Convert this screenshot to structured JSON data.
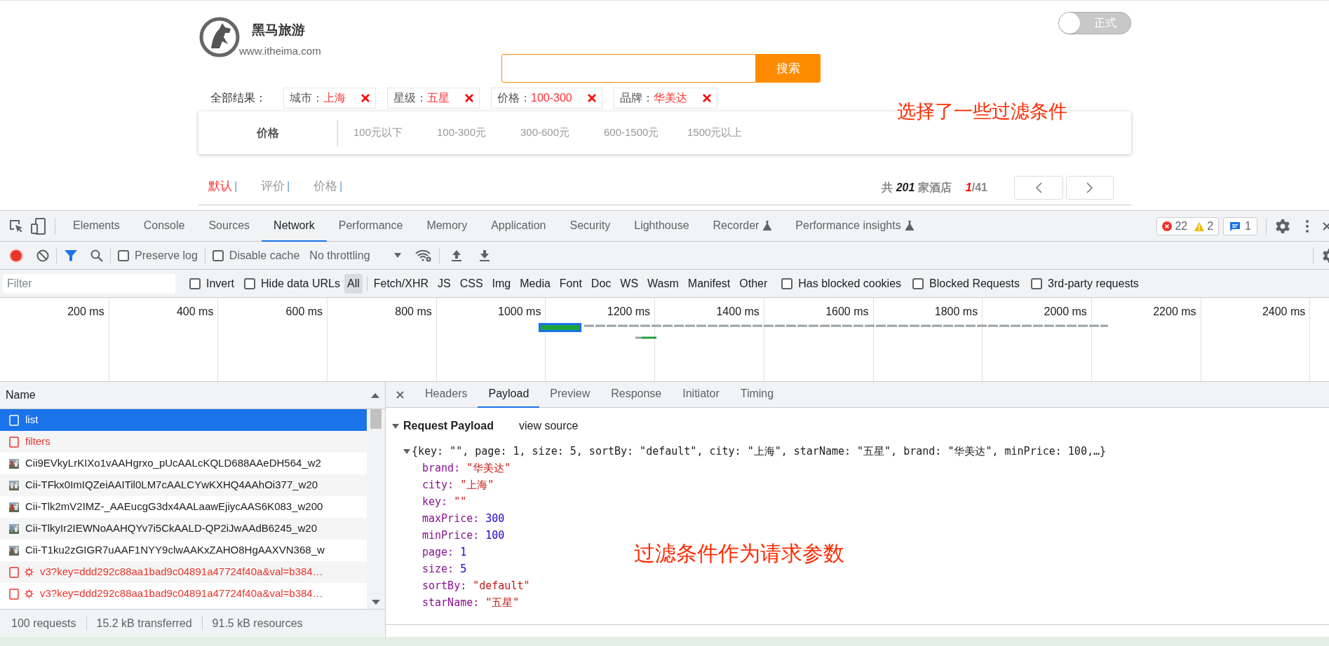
{
  "page": {
    "logo": {
      "title": "黑马旅游",
      "url": "www.itheima.com"
    },
    "env_toggle": {
      "label": "正式",
      "on": false
    },
    "search": {
      "button": "搜索"
    },
    "filters": {
      "label": "全部结果：",
      "tags": [
        {
          "label": "城市：",
          "value": "上海"
        },
        {
          "label": "星级：",
          "value": "五星"
        },
        {
          "label": "价格：",
          "value": "100-300"
        },
        {
          "label": "品牌：",
          "value": "华美达"
        }
      ]
    },
    "annotation": "选择了一些过滤条件",
    "price_filter": {
      "label": "价格",
      "options": [
        "100元以下",
        "100-300元",
        "300-600元",
        "600-1500元",
        "1500元以上"
      ]
    },
    "sort": [
      {
        "label": "默认",
        "separator": "|",
        "selected": true
      },
      {
        "label": "评价",
        "separator": "|",
        "selected": false
      },
      {
        "label": "价格",
        "separator": "|",
        "selected": false
      }
    ],
    "total": "共 *201* 家酒店",
    "page_indicator": "*1*/41"
  },
  "devtools": {
    "tabs": [
      {
        "label": "Elements",
        "selected": false,
        "experimental": false
      },
      {
        "label": "Console",
        "selected": false,
        "experimental": false
      },
      {
        "label": "Sources",
        "selected": false,
        "experimental": false
      },
      {
        "label": "Network",
        "selected": true,
        "experimental": false
      },
      {
        "label": "Performance",
        "selected": false,
        "experimental": false
      },
      {
        "label": "Memory",
        "selected": false,
        "experimental": false
      },
      {
        "label": "Application",
        "selected": false,
        "experimental": false
      },
      {
        "label": "Security",
        "selected": false,
        "experimental": false
      },
      {
        "label": "Lighthouse",
        "selected": false,
        "experimental": false
      },
      {
        "label": "Recorder",
        "selected": false,
        "experimental": true
      },
      {
        "label": "Performance insights",
        "selected": false,
        "experimental": true
      }
    ],
    "issues": {
      "errors": "22",
      "warnings": "2",
      "messages": "1"
    },
    "toolbar": {
      "recording": true,
      "preserve_log": {
        "label": "Preserve log",
        "checked": false
      },
      "disable_cache": {
        "label": "Disable cache",
        "checked": false
      },
      "throttling": "No throttling"
    },
    "filter_bar": {
      "placeholder": "Filter",
      "invert": {
        "label": "Invert",
        "checked": false
      },
      "hide_data_urls": {
        "label": "Hide data URLs",
        "checked": false
      },
      "types": [
        {
          "label": "All",
          "selected": true
        },
        {
          "label": "Fetch/XHR",
          "selected": false
        },
        {
          "label": "JS",
          "selected": false
        },
        {
          "label": "CSS",
          "selected": false
        },
        {
          "label": "Img",
          "selected": false
        },
        {
          "label": "Media",
          "selected": false
        },
        {
          "label": "Font",
          "selected": false
        },
        {
          "label": "Doc",
          "selected": false
        },
        {
          "label": "WS",
          "selected": false
        },
        {
          "label": "Wasm",
          "selected": false
        },
        {
          "label": "Manifest",
          "selected": false
        },
        {
          "label": "Other",
          "selected": false
        }
      ],
      "options": [
        {
          "label": "Has blocked cookies",
          "checked": false
        },
        {
          "label": "Blocked Requests",
          "checked": false
        },
        {
          "label": "3rd-party requests",
          "checked": false
        }
      ]
    },
    "timeline": {
      "ticks": [
        "200 ms",
        "400 ms",
        "600 ms",
        "800 ms",
        "1000 ms",
        "1200 ms",
        "1400 ms",
        "1600 ms",
        "1800 ms",
        "2000 ms",
        "2200 ms",
        "2400 ms"
      ]
    },
    "requests": {
      "column": "Name",
      "rows": [
        {
          "kind": "document",
          "name": "list",
          "selected": true,
          "failed": false
        },
        {
          "kind": "document",
          "name": "filters",
          "selected": false,
          "failed": true
        },
        {
          "name": "Cii9EVkyLrKIXo1vAAHgrxo_pUcAALcKQLD688AAeDH564_w2",
          "selected": false,
          "failed": false
        },
        {
          "name": "Cii-TFkx0ImIQZeiAAITil0LM7cAALCYwKXHQ4AAhOi377_w20",
          "selected": false,
          "failed": false
        },
        {
          "name": "Cii-Tlk2mV2IMZ-_AAEucgG3dx4AALaawEjiycAAS6K083_w200",
          "selected": false,
          "failed": false
        },
        {
          "name": "Cii-TlkyIr2IEWNoAAHQYv7i5CkAALD-QP2iJwAAdB6245_w20",
          "selected": false,
          "failed": false
        },
        {
          "name": "Cii-T1ku2zGIGR7uAAF1NYY9clwAAKxZAHO8HgAAXVN368_w",
          "selected": false,
          "failed": false
        },
        {
          "kind": "ping",
          "name": "v3?key=ddd292c88aa1bad9c04891a47724f40a&val=b384…",
          "selected": false,
          "failed": true
        },
        {
          "kind": "ping",
          "name": "v3?key=ddd292c88aa1bad9c04891a47724f40a&val=b384…",
          "selected": false,
          "failed": true
        }
      ]
    },
    "summary": [
      "100 requests",
      "15.2 kB transferred",
      "91.5 kB resources"
    ],
    "detail": {
      "tabs": [
        {
          "label": "Headers",
          "selected": false
        },
        {
          "label": "Payload",
          "selected": true
        },
        {
          "label": "Preview",
          "selected": false
        },
        {
          "label": "Response",
          "selected": false
        },
        {
          "label": "Initiator",
          "selected": false
        },
        {
          "label": "Timing",
          "selected": false
        }
      ],
      "section": {
        "title": "Request Payload",
        "expanded": true,
        "view_source": "view source"
      },
      "object": {
        "summary": "{key: \"\", page: 1, size: 5, sortBy: \"default\", city: \"上海\", starName: \"五星\", brand: \"华美达\", minPrice: 100,…}",
        "expanded": true,
        "properties": [
          {
            "key": "brand:",
            "value": "\"华美达\"",
            "kind": "string"
          },
          {
            "key": "city:",
            "value": "\"上海\"",
            "kind": "string"
          },
          {
            "key": "key:",
            "value": "\"\"",
            "kind": "string"
          },
          {
            "key": "maxPrice:",
            "value": "300",
            "kind": "number"
          },
          {
            "key": "minPrice:",
            "value": "100",
            "kind": "number"
          },
          {
            "key": "page:",
            "value": "1",
            "kind": "number"
          },
          {
            "key": "size:",
            "value": "5",
            "kind": "number"
          },
          {
            "key": "sortBy:",
            "value": "\"default\"",
            "kind": "string"
          },
          {
            "key": "starName:",
            "value": "\"五星\"",
            "kind": "string"
          }
        ]
      }
    }
  },
  "annotation": "过滤条件作为请求参数"
}
